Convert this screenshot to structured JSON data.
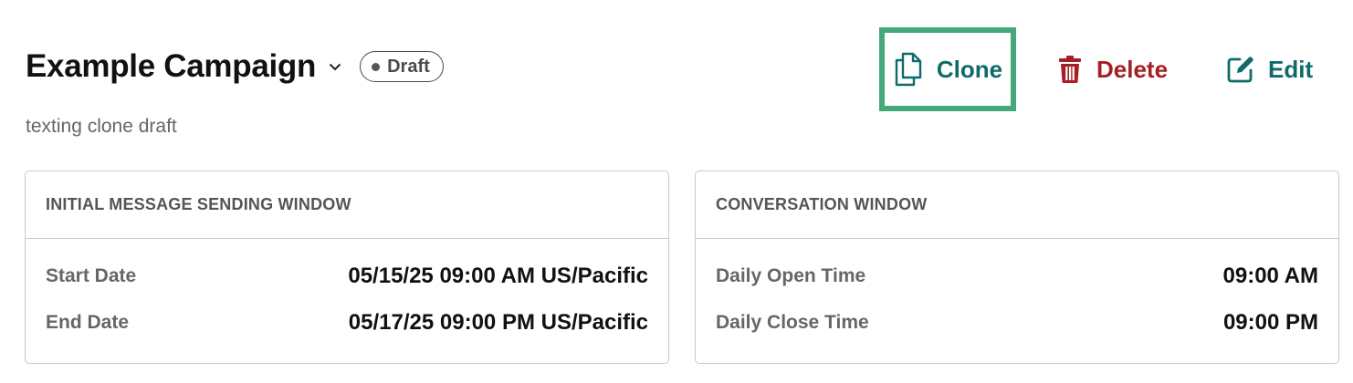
{
  "header": {
    "title": "Example Campaign",
    "status": "Draft",
    "subtitle": "texting clone draft"
  },
  "actions": {
    "clone_label": "Clone",
    "delete_label": "Delete",
    "edit_label": "Edit"
  },
  "icons": {
    "title_chevron": "chevron-down-icon",
    "clone": "copy-icon",
    "delete": "trash-icon",
    "edit": "edit-icon"
  },
  "colors": {
    "teal": "#0f6b6b",
    "danger": "#a52026",
    "highlight": "#45a87a"
  },
  "sending_window": {
    "heading": "INITIAL MESSAGE SENDING WINDOW",
    "rows": [
      {
        "label": "Start Date",
        "value": "05/15/25 09:00 AM US/Pacific"
      },
      {
        "label": "End Date",
        "value": "05/17/25 09:00 PM US/Pacific"
      }
    ]
  },
  "conversation_window": {
    "heading": "CONVERSATION WINDOW",
    "rows": [
      {
        "label": "Daily Open Time",
        "value": "09:00 AM"
      },
      {
        "label": "Daily Close Time",
        "value": "09:00 PM"
      }
    ]
  }
}
